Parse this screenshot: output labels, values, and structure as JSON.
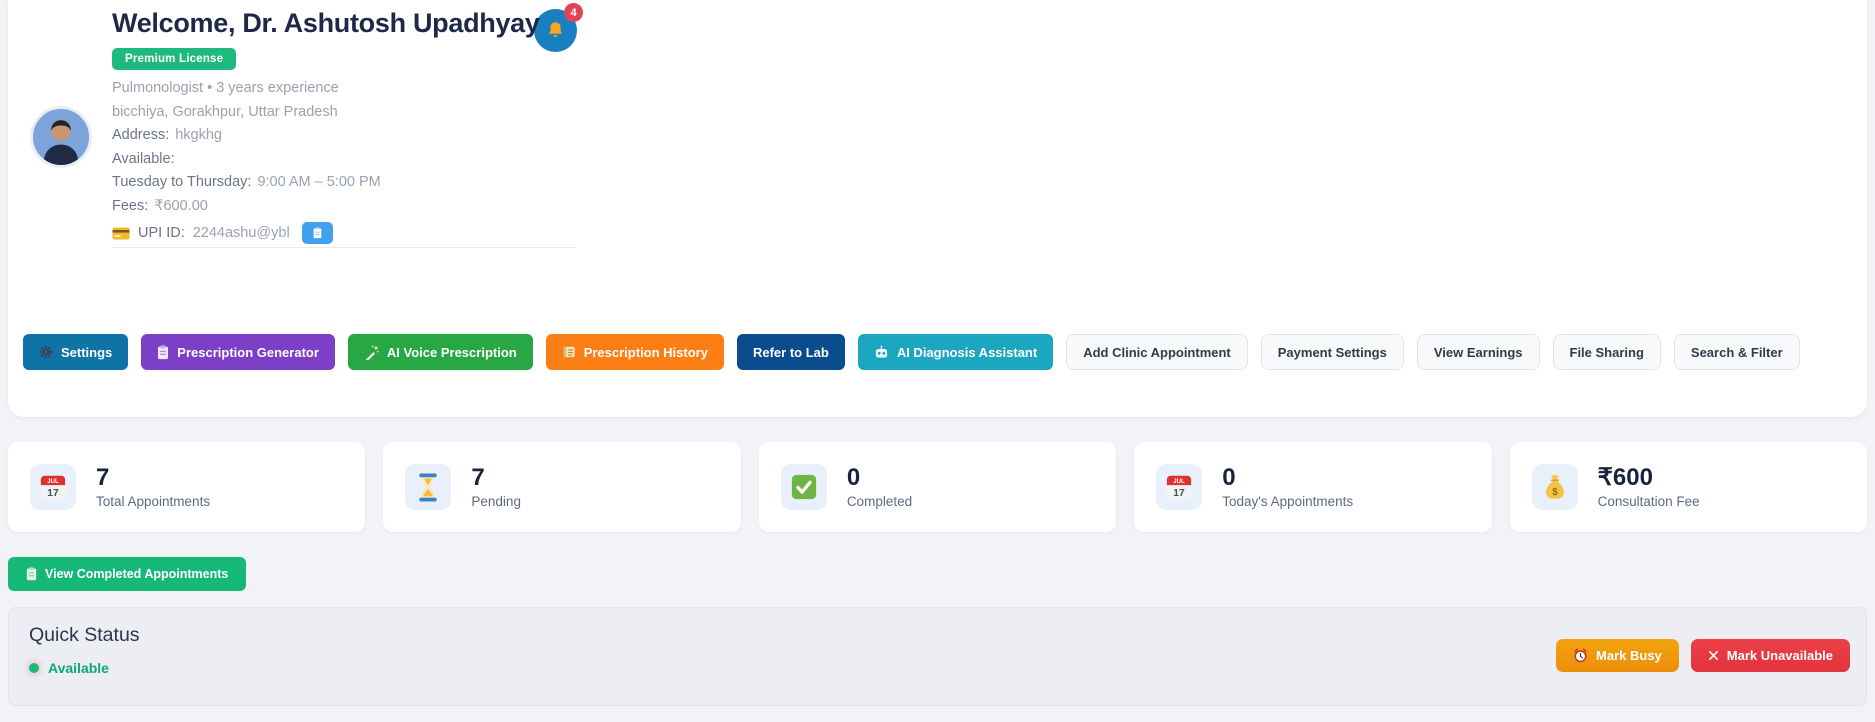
{
  "header": {
    "title": "Welcome, Dr. Ashutosh Upadhyay",
    "license_badge": "Premium License",
    "specialty": "Pulmonologist • 3 years experience",
    "location": "bicchiya, Gorakhpur, Uttar Pradesh",
    "address_label": "Address:",
    "address_value": "hkgkhg",
    "available_label": "Available:",
    "schedule_label": "Tuesday to Thursday:",
    "schedule_value": "9:00 AM – 5:00 PM",
    "fees_label": "Fees:",
    "fees_value": "₹600.00",
    "upi_label": "UPI ID:",
    "upi_value": "2244ashu@ybl",
    "notification_count": "4",
    "icons": {
      "bell": "bell-icon",
      "upi_card": "credit-card-icon",
      "copy": "clipboard-icon"
    }
  },
  "actions": [
    {
      "label": "Settings",
      "icon": "gear-icon"
    },
    {
      "label": "Prescription Generator",
      "icon": "clipboard-icon"
    },
    {
      "label": "AI Voice Prescription",
      "icon": "wand-icon"
    },
    {
      "label": "Prescription History",
      "icon": "scroll-icon"
    },
    {
      "label": "Refer to Lab",
      "icon": ""
    },
    {
      "label": "AI Diagnosis Assistant",
      "icon": "robot-icon"
    },
    {
      "label": "Add Clinic Appointment",
      "icon": ""
    },
    {
      "label": "Payment Settings",
      "icon": ""
    },
    {
      "label": "View Earnings",
      "icon": ""
    },
    {
      "label": "File Sharing",
      "icon": ""
    },
    {
      "label": "Search & Filter",
      "icon": ""
    }
  ],
  "stats": [
    {
      "value": "7",
      "label": "Total Appointments",
      "icon": "calendar-icon"
    },
    {
      "value": "7",
      "label": "Pending",
      "icon": "hourglass-icon"
    },
    {
      "value": "0",
      "label": "Completed",
      "icon": "check-icon"
    },
    {
      "value": "0",
      "label": "Today's Appointments",
      "icon": "calendar-icon"
    },
    {
      "value": "₹600",
      "label": "Consultation Fee",
      "icon": "money-bag-icon"
    }
  ],
  "view_completed_button": {
    "label": "View Completed Appointments",
    "icon": "clipboard-icon"
  },
  "quick_status": {
    "title": "Quick Status",
    "status": "Available",
    "mark_busy": "Mark Busy",
    "mark_unavailable": "Mark Unavailable"
  },
  "colors": {
    "settings_blue": "#0e74a6",
    "generator_purple": "#7d3fc6",
    "voice_green": "#28a745",
    "history_orange": "#fd7e14",
    "lab_navy": "#0a4c8e",
    "diagnosis_teal": "#1aa7bf",
    "license_green": "#1eba7d",
    "completed_green": "#16b877",
    "busy_orange": "#f0970d",
    "unavailable_red": "#e93a42",
    "bell_blue": "#1a7fc0",
    "notification_red": "#e04458",
    "copy_blue": "#41a0f0",
    "available_green": "#0ea776"
  }
}
